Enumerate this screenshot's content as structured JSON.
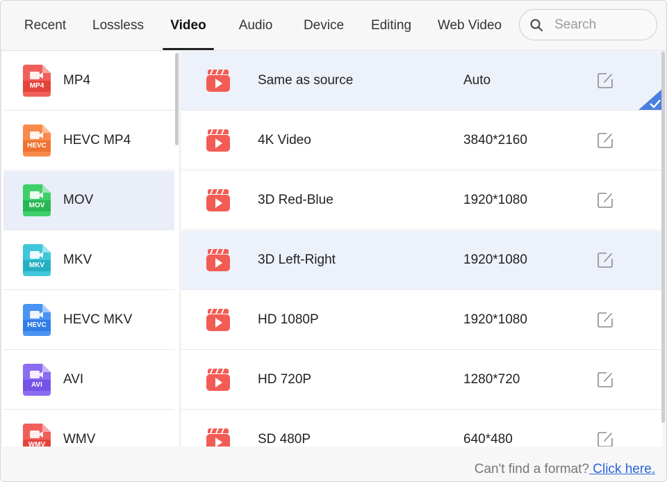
{
  "tabs": [
    {
      "label": "Recent",
      "active": false
    },
    {
      "label": "Lossless",
      "active": false
    },
    {
      "label": "Video",
      "active": true
    },
    {
      "label": "Audio",
      "active": false
    },
    {
      "label": "Device",
      "active": false
    },
    {
      "label": "Editing",
      "active": false
    },
    {
      "label": "Web Video",
      "active": false
    }
  ],
  "search": {
    "placeholder": "Search",
    "value": ""
  },
  "formats": [
    {
      "name": "MP4",
      "tag": "MP4",
      "color": "#f0605a",
      "icon": "video-file-icon"
    },
    {
      "name": "HEVC MP4",
      "tag": "HEVC",
      "color": "#f98a4b",
      "icon": "video-file-icon"
    },
    {
      "name": "MOV",
      "tag": "MOV",
      "color": "#3fcf6a",
      "icon": "video-file-icon",
      "selected": true
    },
    {
      "name": "MKV",
      "tag": "MKV",
      "color": "#3fc7d9",
      "icon": "video-file-icon"
    },
    {
      "name": "HEVC MKV",
      "tag": "HEVC",
      "color": "#4a93f2",
      "icon": "video-file-icon"
    },
    {
      "name": "AVI",
      "tag": "AVI",
      "color": "#8c6cf0",
      "icon": "video-file-icon"
    },
    {
      "name": "WMV",
      "tag": "WMV",
      "color": "#f0605a",
      "icon": "video-file-icon"
    }
  ],
  "presets": [
    {
      "name": "Same as source",
      "resolution": "Auto",
      "selected": true
    },
    {
      "name": "4K Video",
      "resolution": "3840*2160"
    },
    {
      "name": "3D Red-Blue",
      "resolution": "1920*1080"
    },
    {
      "name": "3D Left-Right",
      "resolution": "1920*1080",
      "hover": true
    },
    {
      "name": "HD 1080P",
      "resolution": "1920*1080"
    },
    {
      "name": "HD 720P",
      "resolution": "1280*720"
    },
    {
      "name": "SD 480P",
      "resolution": "640*480"
    }
  ],
  "footer": {
    "text": "Can't find a format?",
    "link": " Click here."
  },
  "colors": {
    "accent": "#4a7fe0",
    "preset_icon": "#f25c54",
    "highlight": "#e9eef9",
    "link": "#2b63d9"
  }
}
